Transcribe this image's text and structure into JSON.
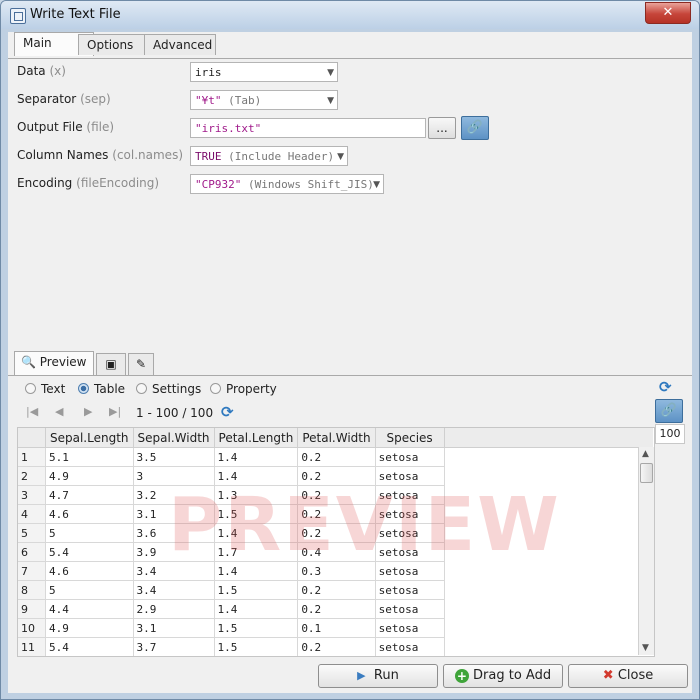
{
  "window": {
    "title": "Write Text File"
  },
  "tabs": [
    {
      "label": "Main"
    },
    {
      "label": "Options"
    },
    {
      "label": "Advanced"
    }
  ],
  "form": {
    "data": {
      "label": "Data",
      "arg": "(x)",
      "value": "iris"
    },
    "separator": {
      "label": "Separator",
      "arg": "(sep)",
      "value": "\"¥t\"",
      "note": "(Tab)"
    },
    "output_file": {
      "label": "Output File",
      "arg": "(file)",
      "value": "\"iris.txt\"",
      "browse_label": "..."
    },
    "column_names": {
      "label": "Column Names",
      "arg": "(col.names)",
      "value": "TRUE",
      "note": "(Include Header)"
    },
    "encoding": {
      "label": "Encoding",
      "arg": "(fileEncoding)",
      "value": "\"CP932\"",
      "note": "(Windows Shift_JIS)"
    }
  },
  "preview": {
    "tab_label": "Preview",
    "modes": [
      {
        "label": "Text"
      },
      {
        "label": "Table",
        "selected": true
      },
      {
        "label": "Settings"
      },
      {
        "label": "Property"
      }
    ],
    "page_info": "1 - 100 / 100",
    "row_limit": "100",
    "watermark": "PREVIEW",
    "columns": [
      "Sepal.Length",
      "Sepal.Width",
      "Petal.Length",
      "Petal.Width",
      "Species"
    ],
    "rows": [
      [
        "1",
        "5.1",
        "3.5",
        "1.4",
        "0.2",
        "setosa"
      ],
      [
        "2",
        "4.9",
        "3",
        "1.4",
        "0.2",
        "setosa"
      ],
      [
        "3",
        "4.7",
        "3.2",
        "1.3",
        "0.2",
        "setosa"
      ],
      [
        "4",
        "4.6",
        "3.1",
        "1.5",
        "0.2",
        "setosa"
      ],
      [
        "5",
        "5",
        "3.6",
        "1.4",
        "0.2",
        "setosa"
      ],
      [
        "6",
        "5.4",
        "3.9",
        "1.7",
        "0.4",
        "setosa"
      ],
      [
        "7",
        "4.6",
        "3.4",
        "1.4",
        "0.3",
        "setosa"
      ],
      [
        "8",
        "5",
        "3.4",
        "1.5",
        "0.2",
        "setosa"
      ],
      [
        "9",
        "4.4",
        "2.9",
        "1.4",
        "0.2",
        "setosa"
      ],
      [
        "10",
        "4.9",
        "3.1",
        "1.5",
        "0.1",
        "setosa"
      ],
      [
        "11",
        "5.4",
        "3.7",
        "1.5",
        "0.2",
        "setosa"
      ]
    ]
  },
  "buttons": {
    "run": "Run",
    "drag_to_add": "Drag to Add",
    "close": "Close"
  },
  "colors": {
    "string": "#a01a8a",
    "accent": "#2f79bf",
    "close": "#d23a2e",
    "add": "#3fa43a",
    "watermark": "#e05a5a"
  },
  "icons": [
    "app-icon",
    "window-close-icon",
    "link-icon",
    "refresh-icon",
    "first-page-icon",
    "prev-page-icon",
    "next-page-icon",
    "last-page-icon",
    "run-icon",
    "add-icon",
    "close-icon",
    "preview-icon",
    "console-icon",
    "script-icon"
  ]
}
